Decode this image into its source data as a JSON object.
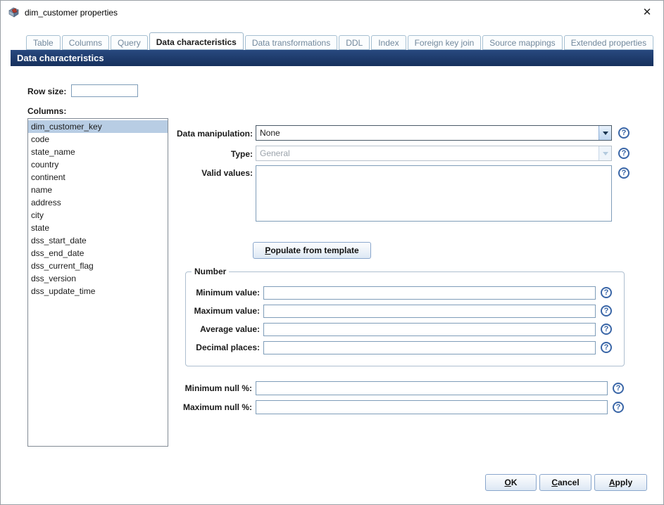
{
  "window": {
    "title": "dim_customer properties",
    "close_icon": "✕"
  },
  "tabs": [
    {
      "label": "Table",
      "active": false
    },
    {
      "label": "Columns",
      "active": false
    },
    {
      "label": "Query",
      "active": false
    },
    {
      "label": "Data characteristics",
      "active": true
    },
    {
      "label": "Data transformations",
      "active": false
    },
    {
      "label": "DDL",
      "active": false
    },
    {
      "label": "Index",
      "active": false
    },
    {
      "label": "Foreign key join",
      "active": false
    },
    {
      "label": "Source mappings",
      "active": false
    },
    {
      "label": "Extended properties",
      "active": false
    }
  ],
  "header": {
    "title": "Data characteristics"
  },
  "row_size": {
    "label": "Row size:",
    "value": ""
  },
  "columns": {
    "label": "Columns:",
    "selected": "dim_customer_key",
    "items": [
      "dim_customer_key",
      "code",
      "state_name",
      "country",
      "continent",
      "name",
      "address",
      "city",
      "state",
      "dss_start_date",
      "dss_end_date",
      "dss_current_flag",
      "dss_version",
      "dss_update_time"
    ]
  },
  "fields": {
    "data_manipulation": {
      "label": "Data manipulation:",
      "value": "None"
    },
    "type": {
      "label": "Type:",
      "value": "General",
      "disabled": true
    },
    "valid_values": {
      "label": "Valid values:",
      "value": ""
    },
    "populate_button": "Populate from template"
  },
  "number_group": {
    "legend": "Number",
    "fields": [
      {
        "label": "Minimum value:",
        "value": ""
      },
      {
        "label": "Maximum value:",
        "value": ""
      },
      {
        "label": "Average value:",
        "value": ""
      },
      {
        "label": "Decimal places:",
        "value": ""
      }
    ]
  },
  "null_fields": [
    {
      "label": "Minimum null %:",
      "value": ""
    },
    {
      "label": "Maximum null %:",
      "value": ""
    }
  ],
  "footer": {
    "ok": "OK",
    "cancel": "Cancel",
    "apply": "Apply"
  },
  "icons": {
    "help": "?"
  },
  "colors": {
    "header_bg": "#1d3867",
    "selection_bg": "#b8cde4",
    "button_border": "#89a6cc",
    "help_blue": "#3a66a7"
  }
}
